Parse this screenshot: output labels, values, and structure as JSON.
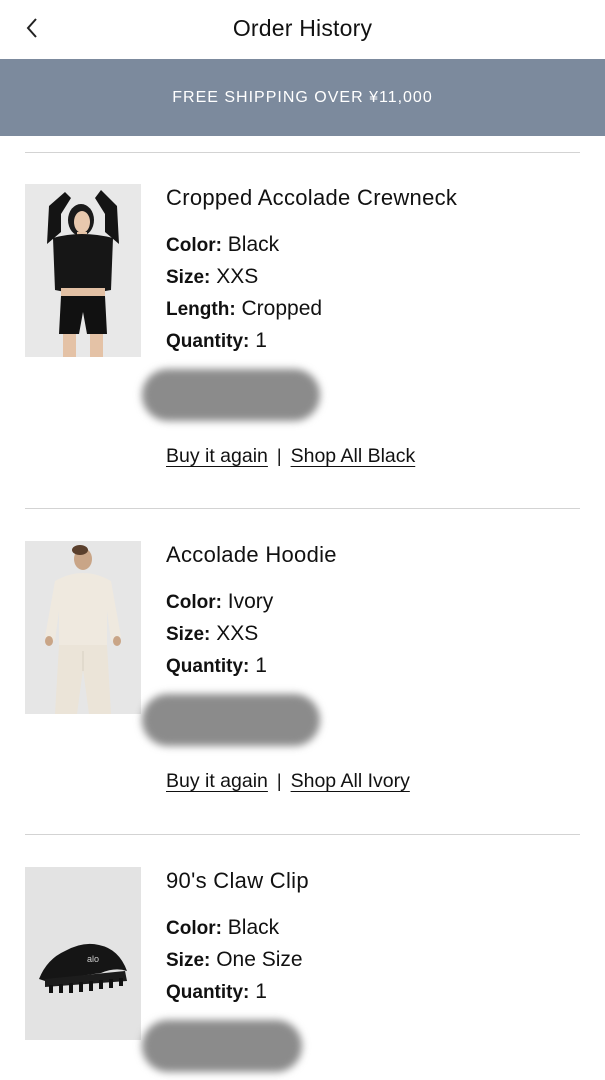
{
  "header": {
    "title": "Order History"
  },
  "banner": {
    "text": "FREE SHIPPING OVER ¥11,000"
  },
  "orders": [
    {
      "name": "Cropped Accolade Crewneck",
      "attrs": [
        {
          "k": "Color:",
          "v": "Black"
        },
        {
          "k": "Size:",
          "v": "XXS"
        },
        {
          "k": "Length:",
          "v": "Cropped"
        },
        {
          "k": "Quantity:",
          "v": "1"
        }
      ],
      "buy_again": "Buy it again",
      "separator": "|",
      "shop_all": "Shop All Black"
    },
    {
      "name": "Accolade Hoodie",
      "attrs": [
        {
          "k": "Color:",
          "v": "Ivory"
        },
        {
          "k": "Size:",
          "v": "XXS"
        },
        {
          "k": "Quantity:",
          "v": "1"
        }
      ],
      "buy_again": "Buy it again",
      "separator": "|",
      "shop_all": "Shop All Ivory"
    },
    {
      "name": "90's Claw Clip",
      "attrs": [
        {
          "k": "Color:",
          "v": "Black"
        },
        {
          "k": "Size:",
          "v": "One Size"
        },
        {
          "k": "Quantity:",
          "v": "1"
        }
      ],
      "clip_logo": "alo"
    }
  ]
}
